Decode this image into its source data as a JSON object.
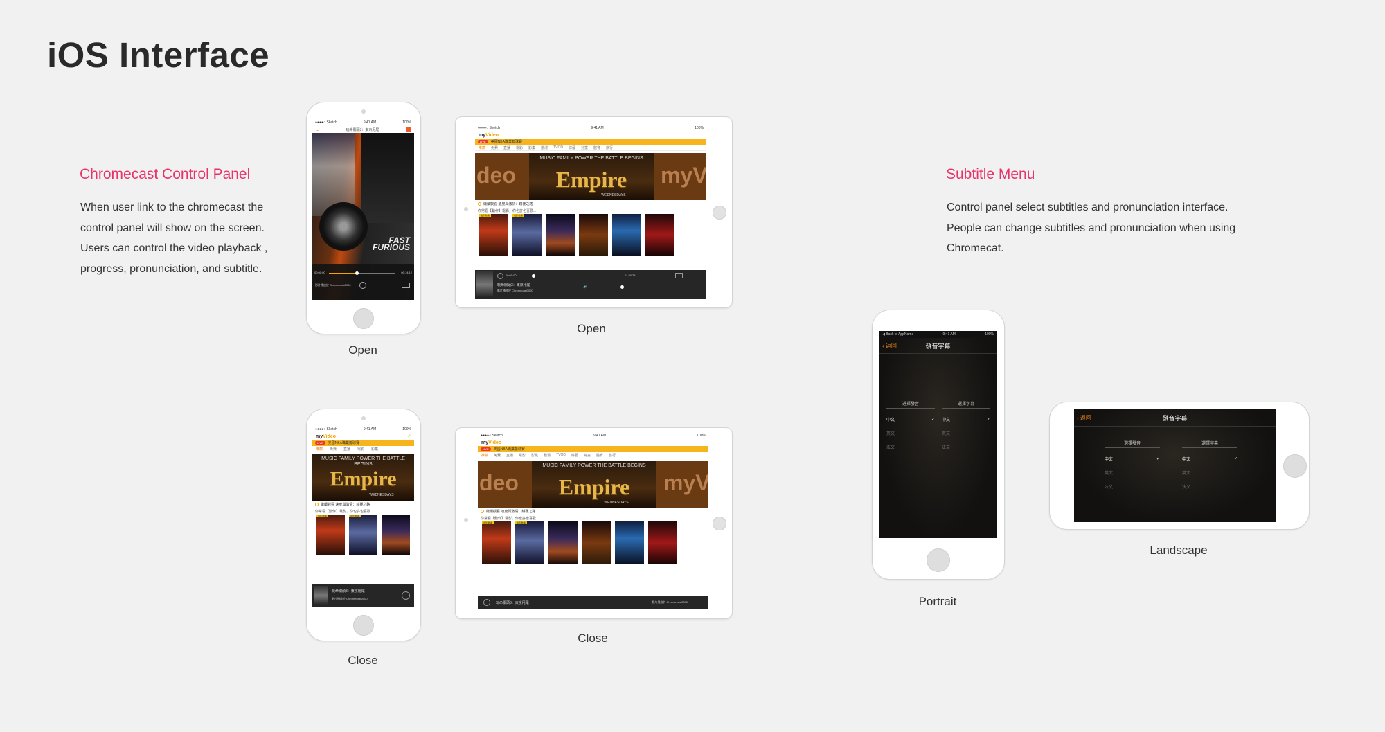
{
  "page_title": "iOS Interface",
  "chromecast": {
    "title": "Chromecast Control Panel",
    "desc": [
      "When user link to the chromecast the",
      "control panel will show on the screen.",
      "Users can control the video playback ,",
      "progress, pronunciation, and subtitle."
    ]
  },
  "subtitle_menu": {
    "title": "Subtitle Menu",
    "desc": [
      "Control panel select subtitles and pronunciation interface.",
      "People can change subtitles and pronunciation when using",
      "Chromecat."
    ]
  },
  "captions": {
    "phone_open": "Open",
    "tablet_open": "Open",
    "phone_close": "Close",
    "tablet_close": "Close",
    "portrait": "Portrait",
    "landscape": "Landscape"
  },
  "status_bar": {
    "carrier": "●●●●○ Sketch",
    "time": "9:41 AM",
    "battery": "100%",
    "back_to_app": "◀ Back to AppName"
  },
  "app": {
    "logo_main": "my",
    "logo_accent": "Video",
    "live_badge": "LIVE",
    "live_text": "美國NBA職業籃球賽",
    "tabs": [
      "推薦",
      "免費",
      "直播",
      "電影",
      "影集",
      "動漫",
      "TVOD",
      "綜藝",
      "兒童",
      "體育",
      "旅行"
    ],
    "hero_tagline": "MUSIC FAMILY POWER THE BATTLE BEGINS",
    "hero_title": "Empire",
    "hero_sub": "WEDNESDAYS",
    "side_left": "deo",
    "side_right": "myV",
    "row1": "繼續觀看 速度與激情：鐵甕之路",
    "row2": "你常看【動作】電影，你也許也喜歡...",
    "poster_label": "電影/動畫",
    "movie_title": "玩命關頭3：東京甩尾",
    "device": "影片播放於 Chromecast0000",
    "time_start": "00:00:00",
    "time_end": "01:20:24",
    "phone_time_start": "00:00:00",
    "phone_time_end": "00:14:12"
  },
  "subtitle_panel": {
    "back": "返回",
    "title": "發音字幕",
    "col1_header": "選擇發音",
    "col2_header": "選擇字幕",
    "items": [
      "中文",
      "英文",
      "法文"
    ],
    "selected": "中文"
  },
  "colors": {
    "accent_pink": "#e8336a",
    "brand_orange": "#f5a300",
    "background": "#f0f1f0"
  }
}
